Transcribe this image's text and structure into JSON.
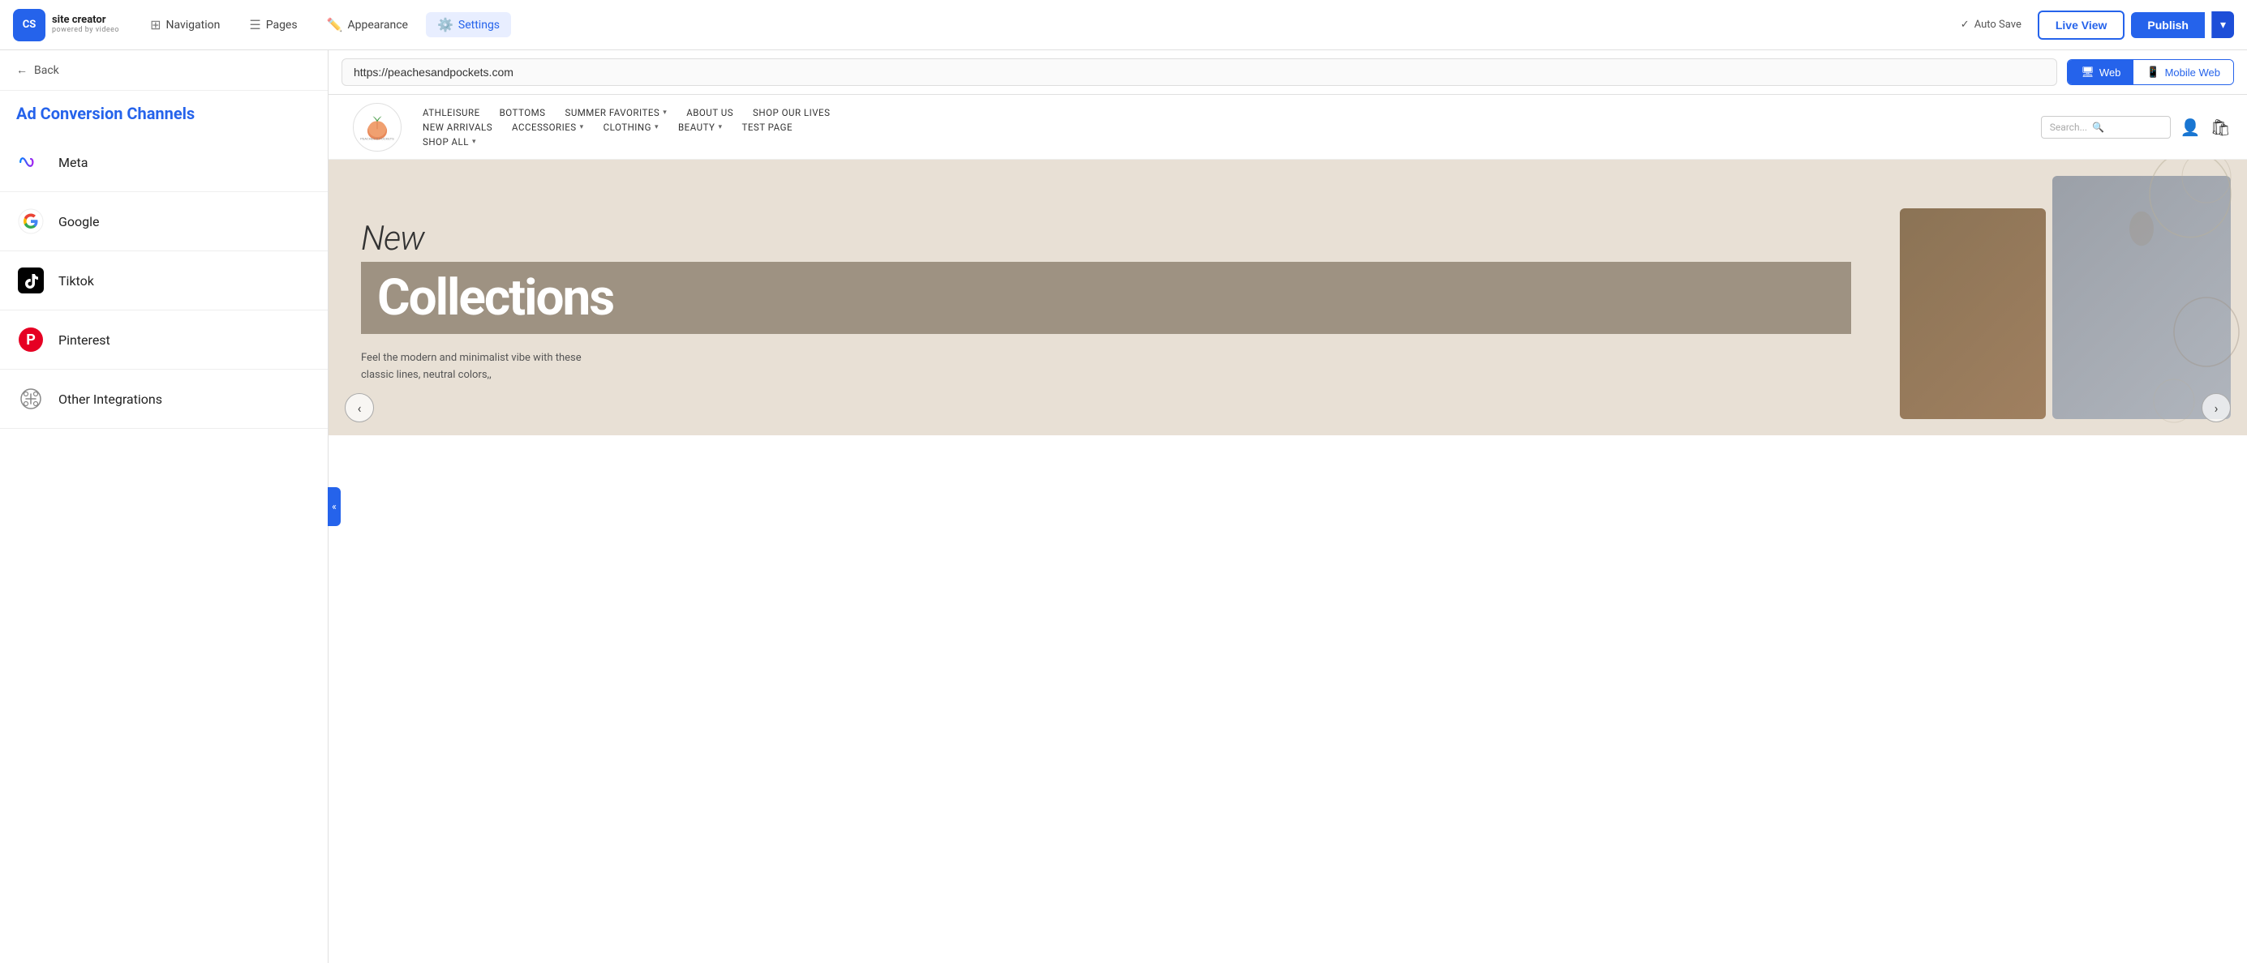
{
  "brand": {
    "logo_initials": "CS",
    "title": "site creator",
    "subtitle": "powered by videeo"
  },
  "top_nav": {
    "items": [
      {
        "id": "navigation",
        "label": "Navigation",
        "icon": "nav-icon"
      },
      {
        "id": "pages",
        "label": "Pages",
        "icon": "pages-icon"
      },
      {
        "id": "appearance",
        "label": "Appearance",
        "icon": "appearance-icon"
      },
      {
        "id": "settings",
        "label": "Settings",
        "icon": "settings-icon"
      }
    ],
    "active_item": "settings",
    "auto_save_label": "Auto Save",
    "live_view_label": "Live View",
    "publish_label": "Publish"
  },
  "sidebar": {
    "back_label": "Back",
    "title": "Ad Conversion Channels",
    "items": [
      {
        "id": "meta",
        "label": "Meta"
      },
      {
        "id": "google",
        "label": "Google"
      },
      {
        "id": "tiktok",
        "label": "Tiktok"
      },
      {
        "id": "pinterest",
        "label": "Pinterest"
      },
      {
        "id": "other",
        "label": "Other Integrations"
      }
    ]
  },
  "url_bar": {
    "url": "https://peachesandpockets.com",
    "web_label": "Web",
    "mobile_label": "Mobile Web"
  },
  "site_nav": {
    "row1": [
      {
        "label": "ATHLEISURE",
        "has_dropdown": false
      },
      {
        "label": "BOTTOMS",
        "has_dropdown": false
      },
      {
        "label": "SUMMER FAVORITES",
        "has_dropdown": true
      },
      {
        "label": "ABOUT US",
        "has_dropdown": false
      },
      {
        "label": "SHOP OUR LIVES",
        "has_dropdown": false
      }
    ],
    "row2": [
      {
        "label": "NEW ARRIVALS",
        "has_dropdown": false
      },
      {
        "label": "ACCESSORIES",
        "has_dropdown": true
      },
      {
        "label": "CLOTHING",
        "has_dropdown": true
      },
      {
        "label": "BEAUTY",
        "has_dropdown": true
      },
      {
        "label": "TEST PAGE",
        "has_dropdown": false
      }
    ],
    "row3": [
      {
        "label": "SHOP ALL",
        "has_dropdown": true
      }
    ],
    "search_placeholder": "Search..."
  },
  "hero": {
    "new_label": "New",
    "collections_label": "Collections",
    "description": "Feel the modern and minimalist vibe with these classic lines, neutral colors,,",
    "prev_arrow": "‹",
    "next_arrow": "›"
  },
  "colors": {
    "accent": "#2563eb",
    "accent_dark": "#1d4ed8",
    "sidebar_title": "#2563eb",
    "collapse_tab": "#2563eb"
  }
}
